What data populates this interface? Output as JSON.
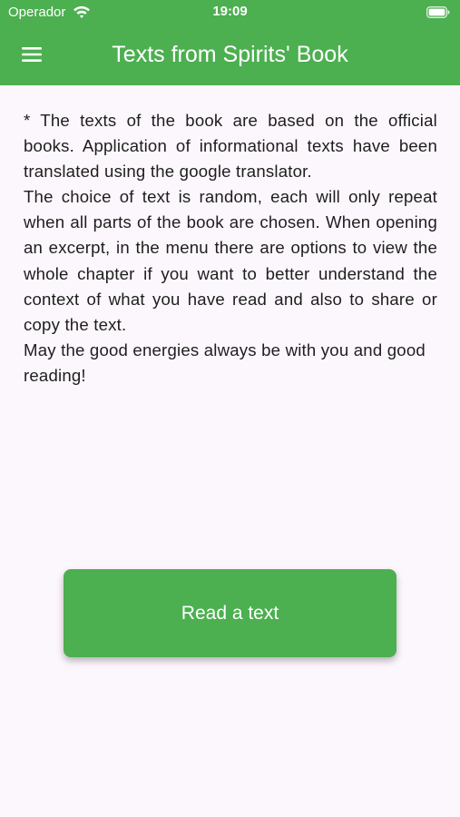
{
  "status_bar": {
    "carrier": "Operador",
    "time": "19:09",
    "wifi_icon": "wifi-icon",
    "battery_icon": "battery-icon"
  },
  "app_bar": {
    "menu_icon": "hamburger-menu-icon",
    "title": "Texts from Spirits' Book",
    "background_color": "#4caf50"
  },
  "content": {
    "paragraphs": [
      "* The texts of the book are based on the official books. Application of informational texts have been translated using the google translator.",
      "The choice of text is random, each will only repeat when all parts of the book are chosen. When opening an excerpt, in the menu there are options to view the whole chapter if you want to better understand the context of what you have read and also to share or copy the text.",
      "May the good energies always be with you and good reading!"
    ]
  },
  "actions": {
    "read_button_label": "Read a text",
    "button_color": "#4caf50"
  }
}
